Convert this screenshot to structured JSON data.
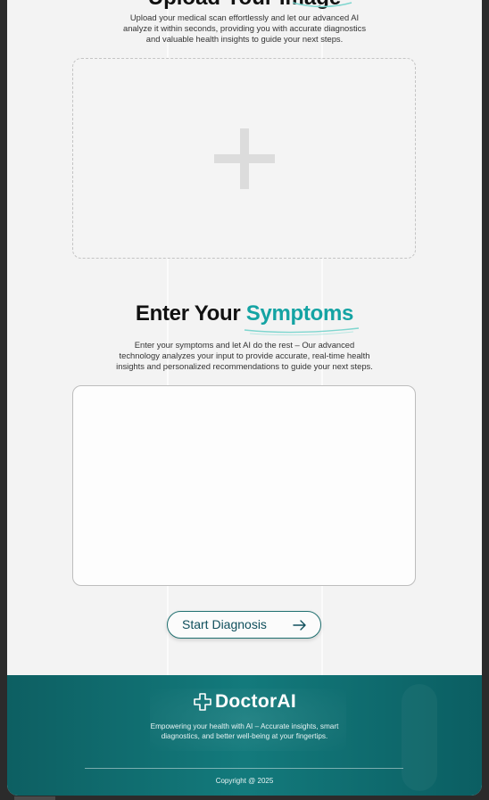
{
  "upload_section": {
    "title": "Upload Your Image",
    "description_lines": [
      "Upload your medical scan effortlessly and let our advanced AI",
      "analyze it within seconds, providing you with accurate diagnostics",
      "and valuable health insights to guide your next steps."
    ]
  },
  "symptoms_section": {
    "title_prefix": "Enter Your ",
    "title_accent": "Symptoms",
    "description_lines": [
      "Enter your symptoms and let AI do the rest – Our advanced",
      "technology analyzes your input to provide accurate, real-time health",
      "insights and personalized recommendations to guide your next steps."
    ],
    "input_value": "",
    "input_placeholder": ""
  },
  "actions": {
    "start_label": "Start Diagnosis"
  },
  "footer": {
    "brand_name": "DoctorAI",
    "tagline_lines": [
      "Empowering your health with AI – Accurate insights, smart",
      "diagnostics, and better well-being at your fingertips."
    ],
    "copyright": "Copyright @ 2025"
  },
  "icons": {
    "upload": "plus-icon",
    "start": "arrow-right-icon",
    "brand": "medical-cross-icon"
  },
  "colors": {
    "accent": "#14a3a3",
    "footer_bg": "#137a7c",
    "button_text": "#0f4f5c"
  }
}
